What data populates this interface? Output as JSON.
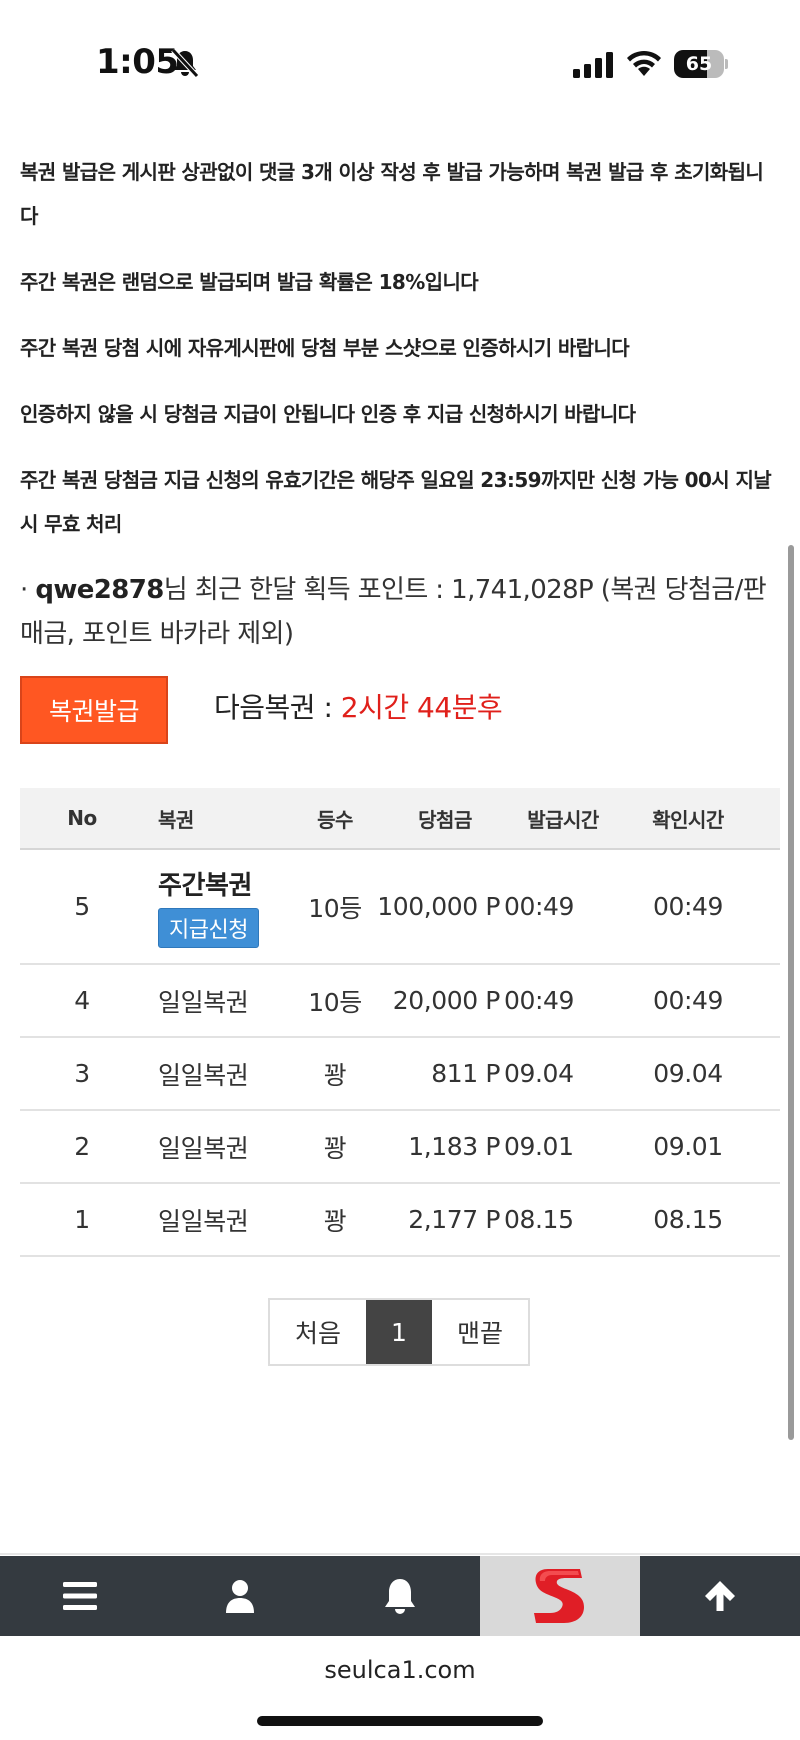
{
  "status_bar": {
    "time": "1:05",
    "battery": "65",
    "battery_fraction": 0.65
  },
  "notices": [
    "복권 발급은 게시판 상관없이 댓글 3개 이상 작성 후 발급 가능하며 복권 발급 후 초기화됩니다",
    "주간 복권은 랜덤으로 발급되며 발급 확률은 18%입니다",
    "주간 복권 당첨 시에 자유게시판에 당첨 부분 스샷으로 인증하시기 바랍니다",
    "인증하지 않을 시 당첨금 지급이 안됩니다 인증 후 지급 신청하시기 바랍니다",
    "주간 복권 당첨금 지급 신청의 유효기간은 해당주 일요일 23:59까지만 신청 가능 00시 지날 시 무효 처리"
  ],
  "points": {
    "bullet": "·",
    "username": "qwe2878",
    "text": "님 최근 한달 획득 포인트 : 1,741,028P (복권 당첨금/판매금, 포인트 바카라 제외)"
  },
  "issue_button": "복권발급",
  "next_ticket": {
    "label": "다음복권 : ",
    "remaining": "2시간 44분후"
  },
  "table": {
    "headers": {
      "no": "No",
      "name": "복권",
      "rank": "등수",
      "prize": "당첨금",
      "issued": "발급시간",
      "checked": "확인시간"
    },
    "rows": [
      {
        "no": "5",
        "name": "주간복권",
        "claim": "지급신청",
        "rank": "10등",
        "prize": "100,000 P",
        "issued": "00:49",
        "checked": "00:49"
      },
      {
        "no": "4",
        "name": "일일복권",
        "rank": "10등",
        "prize": "20,000 P",
        "issued": "00:49",
        "checked": "00:49"
      },
      {
        "no": "3",
        "name": "일일복권",
        "rank": "꽝",
        "prize": "811 P",
        "issued": "09.04",
        "checked": "09.04"
      },
      {
        "no": "2",
        "name": "일일복권",
        "rank": "꽝",
        "prize": "1,183 P",
        "issued": "09.01",
        "checked": "09.01"
      },
      {
        "no": "1",
        "name": "일일복권",
        "rank": "꽝",
        "prize": "2,177 P",
        "issued": "08.15",
        "checked": "08.15"
      }
    ]
  },
  "pagination": {
    "first": "처음",
    "current": "1",
    "last": "맨끝"
  },
  "bottom_nav": {
    "icons": [
      "menu-icon",
      "user-icon",
      "bell-icon",
      "site-logo",
      "arrow-up-icon"
    ],
    "logo_letter": "S"
  },
  "url": "seulca1.com",
  "colors": {
    "accent": "#ff5722",
    "remaining_time": "#e0201b",
    "claim_button": "#3f8fd6",
    "nav_background": "#343a40",
    "pagination_active": "#444444",
    "logo": "#e01e26"
  }
}
